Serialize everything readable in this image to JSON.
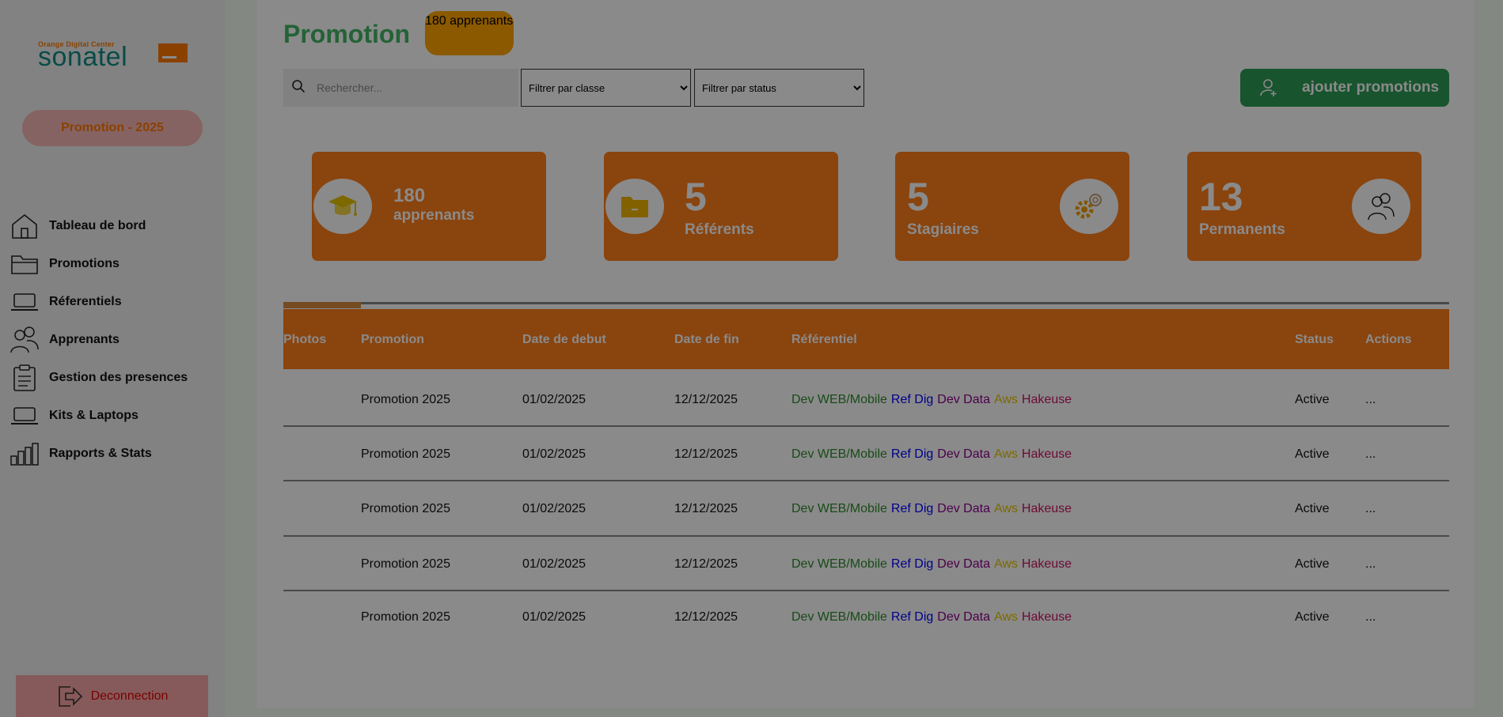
{
  "sidebar": {
    "logo_top": "Orange Digital Center",
    "logo_main": "sonatel",
    "promo_pill": "Promotion - 2025",
    "items": [
      {
        "label": "Tableau de bord",
        "icon": "home-icon"
      },
      {
        "label": "Promotions",
        "icon": "folder-icon"
      },
      {
        "label": "Réferentiels",
        "icon": "laptop-icon"
      },
      {
        "label": "Apprenants",
        "icon": "users-icon"
      },
      {
        "label": "Gestion des presences",
        "icon": "clipboard-icon"
      },
      {
        "label": "Kits & Laptops",
        "icon": "laptop-icon"
      },
      {
        "label": "Rapports & Stats",
        "icon": "bar-chart-icon"
      }
    ],
    "logout": "Deconnection"
  },
  "header": {
    "title": "Promotion",
    "count_label": "180 apprenants"
  },
  "filters": {
    "search_placeholder": "Rechercher...",
    "class_filter": "Filtrer par classe",
    "status_filter": "Filtrer par status",
    "add_button": "ajouter promotions"
  },
  "stats": [
    {
      "value": "180",
      "label": "apprenants",
      "icon": "graduation-cap-icon"
    },
    {
      "value": "5",
      "label": "Référents",
      "icon": "folder-icon"
    },
    {
      "value": "5",
      "label": "Stagiaires",
      "icon": "gears-icon"
    },
    {
      "value": "13",
      "label": "Permanents",
      "icon": "users-icon"
    }
  ],
  "table": {
    "headers": [
      "Photos",
      "Promotion",
      "Date de debut",
      "Date de fin",
      "Référentiel",
      "Status",
      "Actions"
    ],
    "rows": [
      {
        "promotion": "Promotion 2025",
        "start": "01/02/2025",
        "end": "12/12/2025",
        "status": "Active",
        "actions": "..."
      },
      {
        "promotion": "Promotion 2025",
        "start": "01/02/2025",
        "end": "12/12/2025",
        "status": "Active",
        "actions": "..."
      },
      {
        "promotion": "Promotion 2025",
        "start": "01/02/2025",
        "end": "12/12/2025",
        "status": "Active",
        "actions": "..."
      },
      {
        "promotion": "Promotion 2025",
        "start": "01/02/2025",
        "end": "12/12/2025",
        "status": "Active",
        "actions": "..."
      },
      {
        "promotion": "Promotion 2025",
        "start": "01/02/2025",
        "end": "12/12/2025",
        "status": "Active",
        "actions": "..."
      }
    ],
    "referentiels": [
      {
        "label": "Dev WEB/Mobile",
        "color": "#2e8b2e"
      },
      {
        "label": "Ref Dig",
        "color": "#0000ff"
      },
      {
        "label": "Dev Data",
        "color": "#8b008b"
      },
      {
        "label": "Aws",
        "color": "#e6c200"
      },
      {
        "label": "Hakeuse",
        "color": "#c71560"
      }
    ]
  },
  "colors": {
    "accent_orange": "#ff7f1a",
    "brand_green": "#43b567",
    "button_green": "#2e9c56",
    "logout_red": "#e00000"
  }
}
